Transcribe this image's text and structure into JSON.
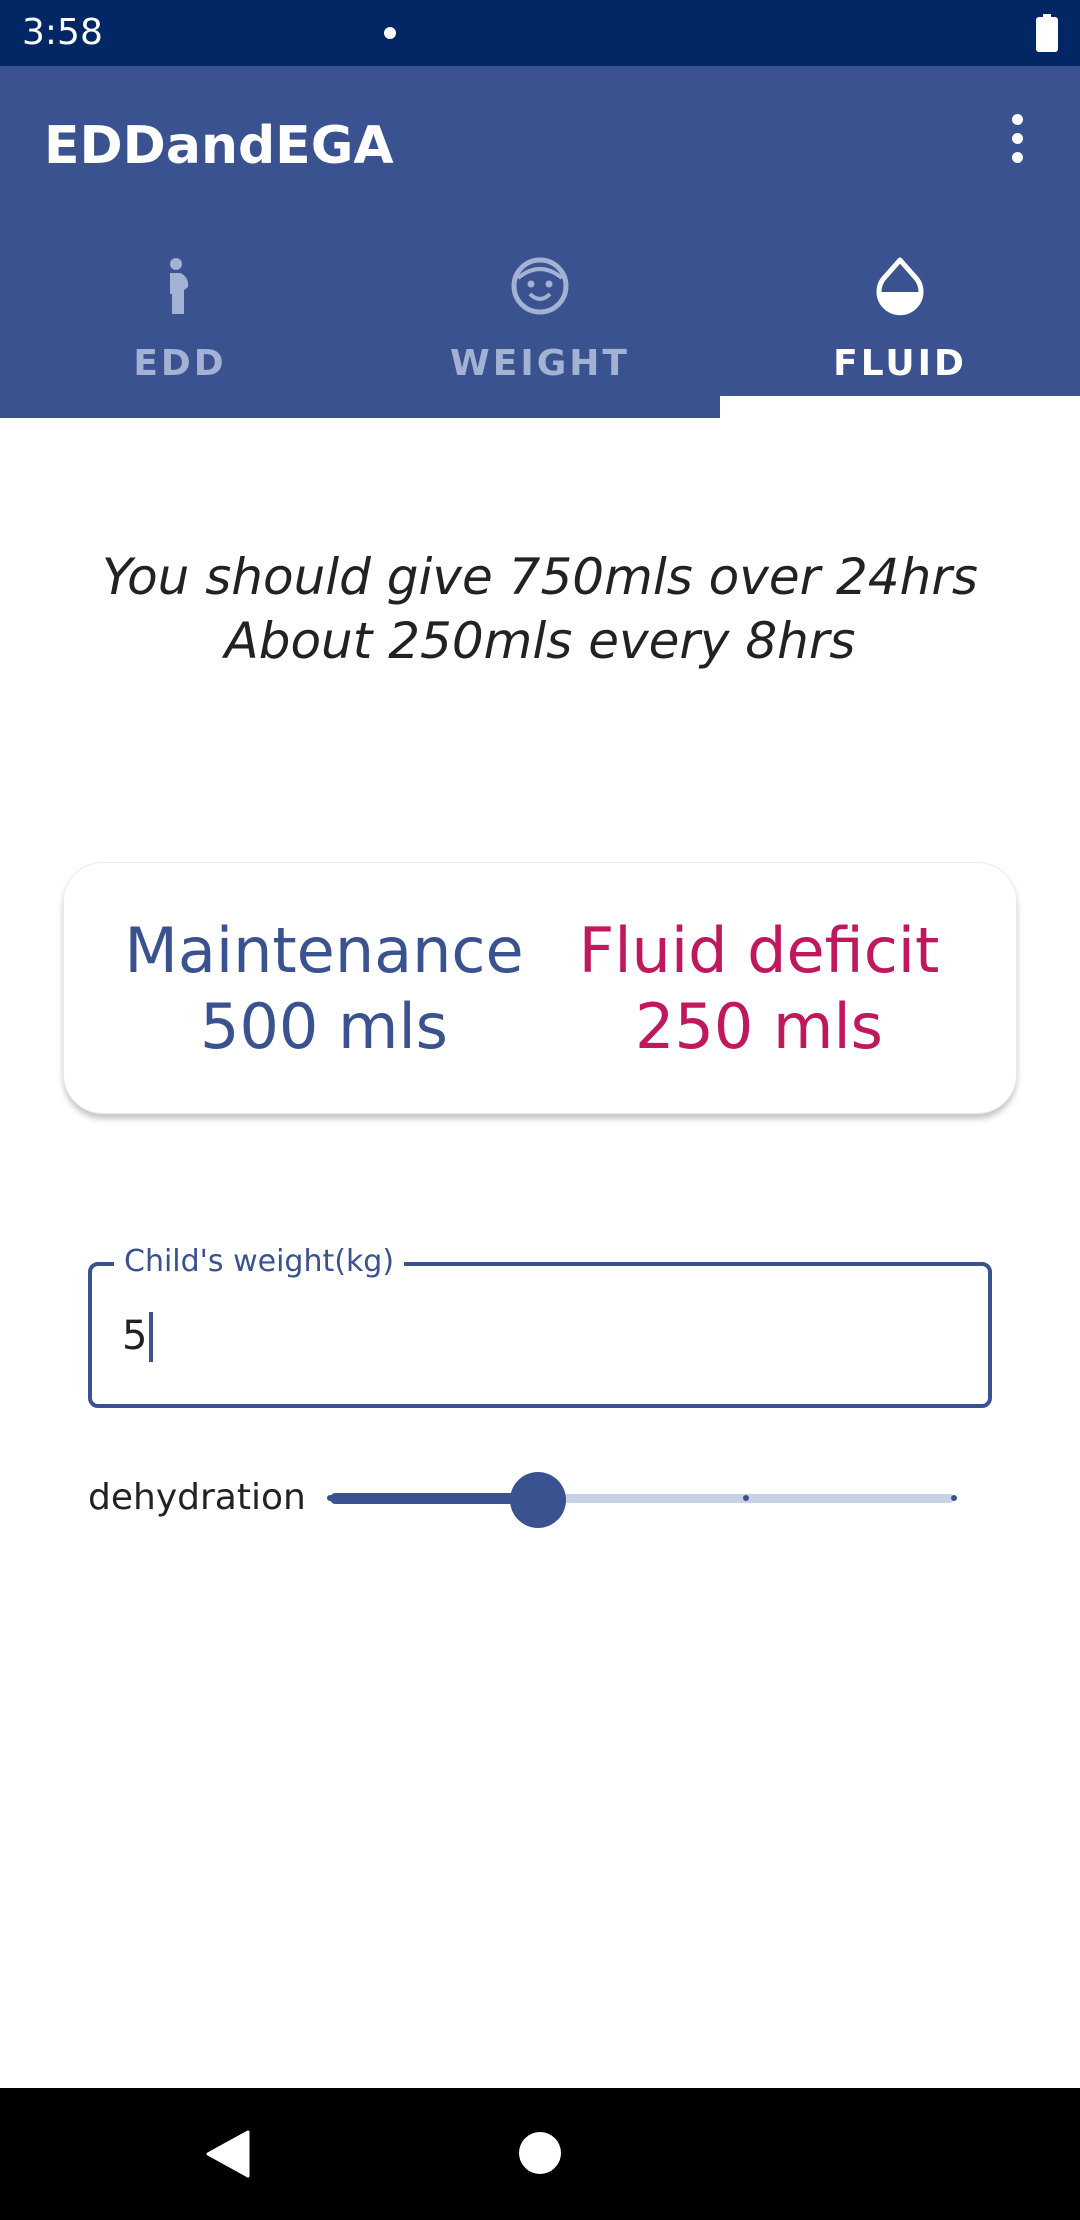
{
  "status_bar": {
    "time": "3:58"
  },
  "app_bar": {
    "title": "EDDandEGA"
  },
  "tabs": [
    {
      "label": "EDD",
      "icon": "pregnant-woman-icon",
      "active": false
    },
    {
      "label": "WEIGHT",
      "icon": "baby-face-icon",
      "active": false
    },
    {
      "label": "FLUID",
      "icon": "water-drop-icon",
      "active": true
    }
  ],
  "result": {
    "line1": "You should give 750mls over 24hrs",
    "line2": "About 250mls every 8hrs"
  },
  "card": {
    "maintenance_label": "Maintenance",
    "maintenance_value": "500 mls",
    "deficit_label": "Fluid deficit",
    "deficit_value": "250 mls"
  },
  "weight_input": {
    "label": "Child's weight(kg)",
    "value": "5"
  },
  "dehydration": {
    "label": "dehydration",
    "value": 1,
    "steps": 3
  },
  "colors": {
    "primary": "#3a528f",
    "status_bar": "#022764",
    "deficit": "#c0175d"
  }
}
